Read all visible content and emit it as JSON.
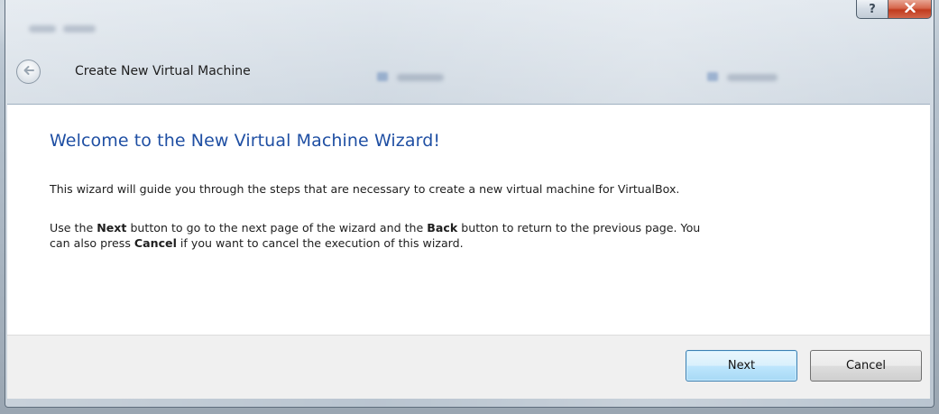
{
  "window": {
    "title": "Create New Virtual Machine",
    "help_label": "?",
    "close_label": "X"
  },
  "wizard": {
    "heading": "Welcome to the New Virtual Machine Wizard!",
    "intro": "This wizard will guide you through the steps that are necessary to create a new virtual machine for VirtualBox.",
    "para2": {
      "part1": "Use the ",
      "next": "Next",
      "part2": " button to go to the next page of the wizard and the ",
      "back": "Back",
      "part3": " button to return to the previous page. You",
      "part4": "can also press ",
      "cancel": "Cancel",
      "part5": " if you want to cancel the execution of this wizard."
    }
  },
  "buttons": {
    "next_label": "Next",
    "cancel_label": "Cancel"
  },
  "icons": {
    "back": "back-arrow-icon",
    "help": "help-icon",
    "close": "close-icon"
  },
  "colors": {
    "heading": "#1f4fa3",
    "close_button": "#c13b1e",
    "default_button_border": "#3c7fb1"
  }
}
